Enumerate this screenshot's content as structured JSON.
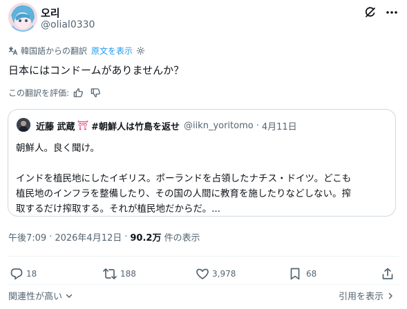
{
  "author": {
    "display_name": "오리",
    "handle": "@olial0330"
  },
  "translation": {
    "notice": "韓国語からの翻訳",
    "show_original": "原文を表示",
    "rate_prompt": "この翻訳を評価:"
  },
  "post": {
    "text": "日本にはコンドームがありませんか？",
    "time": "午後7:09",
    "separator": "·",
    "date": "2026年4月12日",
    "views_count": "90.2万",
    "views_label": "件の表示"
  },
  "quote": {
    "name": "近藤 武蔵",
    "emoji": "⛩",
    "hashtag": "#朝鮮人は竹島を返せ",
    "handle": "@iikn_yoritomo",
    "separator": "·",
    "date": "4月11日",
    "line1": "朝鮮人。良く聞け。",
    "line2": "インドを植民地にしたイギリス。ポーランドを占領したナチス・ドイツ。どこも",
    "line3": "植民地のインフラを整備したり、その国の人間に教育を施したりなどしない。搾",
    "line4": "取するだけ搾取する。それが植民地だからだ。..."
  },
  "actions": {
    "replies": "18",
    "reposts": "188",
    "likes": "3,978",
    "bookmarks": "68"
  },
  "footer": {
    "sort_label": "関連性が高い",
    "quotes_link": "引用を表示"
  },
  "colors": {
    "text": "#0f1419",
    "secondary": "#536471",
    "link": "#1d9bf0",
    "border": "#cfd9de",
    "shrine": "#e0245e"
  },
  "icons": [
    "grok-icon",
    "more-icon",
    "translate-icon",
    "settings-gear-icon",
    "thumbs-up-icon",
    "thumbs-down-icon",
    "reply-icon",
    "repost-icon",
    "like-icon",
    "bookmark-icon",
    "share-icon",
    "chevron-down-icon",
    "chevron-right-icon"
  ]
}
